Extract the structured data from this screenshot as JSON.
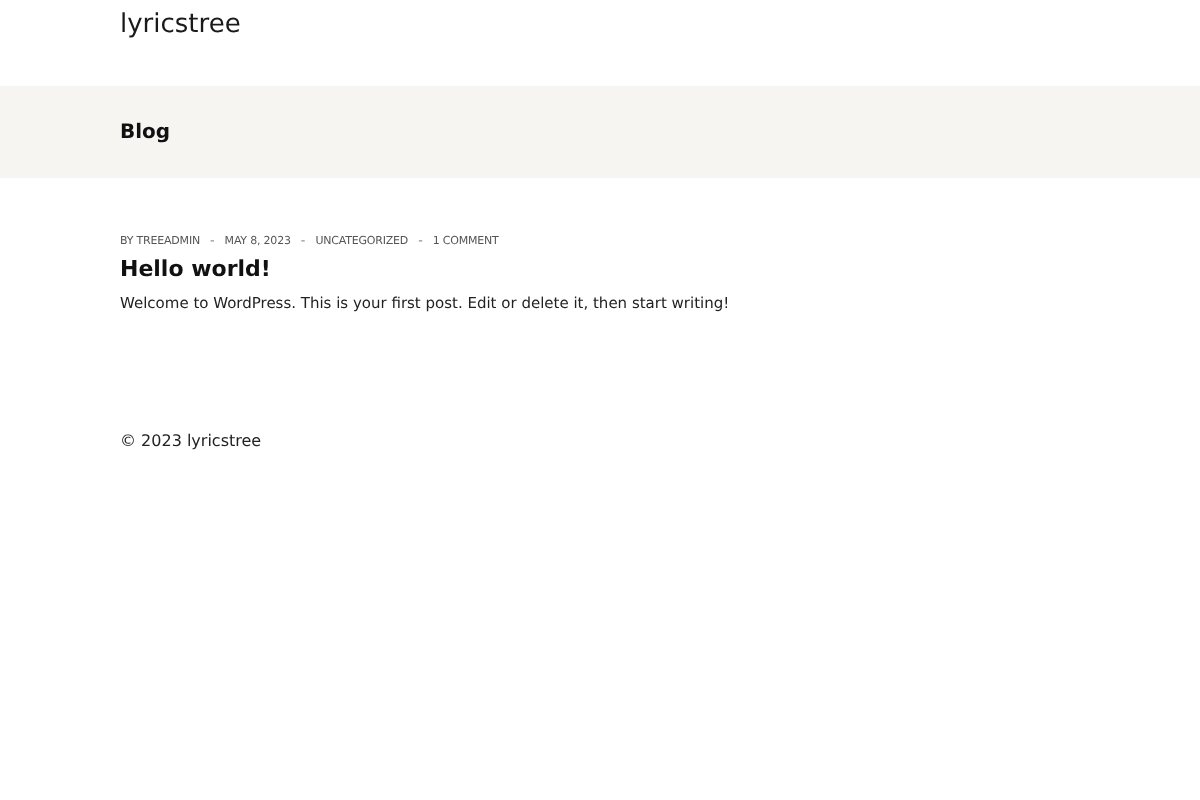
{
  "site_title": "lyricstree",
  "page_banner": {
    "title": "Blog"
  },
  "posts": [
    {
      "meta": [
        {
          "kind": "text",
          "text": "BY TREEADMIN"
        },
        {
          "kind": "separator",
          "text": "-"
        },
        {
          "kind": "text",
          "text": "MAY 8, 2023"
        },
        {
          "kind": "separator",
          "text": "-"
        },
        {
          "kind": "text",
          "text": "UNCATEGORIZED"
        },
        {
          "kind": "separator",
          "text": "-"
        },
        {
          "kind": "text",
          "text": "1 COMMENT"
        }
      ],
      "title": "Hello world!",
      "excerpt": "Welcome to WordPress. This is your first post. Edit or delete it, then start writing!"
    }
  ],
  "footer": {
    "copyright": "© 2023 lyricstree"
  }
}
